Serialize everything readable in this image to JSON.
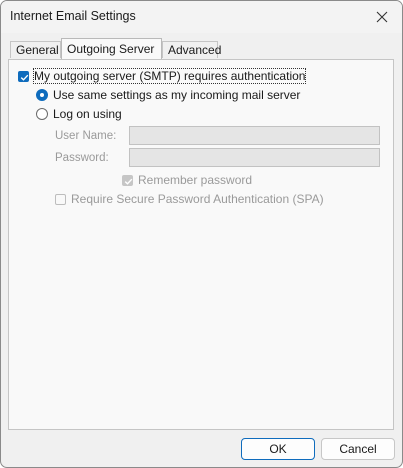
{
  "window": {
    "title": "Internet Email Settings",
    "close_icon": "close-icon"
  },
  "tabs": [
    {
      "label": "General",
      "selected": false
    },
    {
      "label": "Outgoing Server",
      "selected": true
    },
    {
      "label": "Advanced",
      "selected": false
    }
  ],
  "outgoing": {
    "requires_auth_label": "My outgoing server (SMTP) requires authentication",
    "requires_auth_checked": true,
    "same_settings_label": "Use same settings as my incoming mail server",
    "same_settings_selected": true,
    "log_on_label": "Log on using",
    "log_on_selected": false,
    "username_label": "User Name:",
    "username_value": "",
    "password_label": "Password:",
    "password_value": "",
    "remember_label": "Remember password",
    "remember_checked": true,
    "spa_label": "Require Secure Password Authentication (SPA)",
    "spa_checked": false
  },
  "buttons": {
    "ok": "OK",
    "cancel": "Cancel"
  },
  "colors": {
    "accent": "#0f6cbd",
    "disabled_text": "#9a9a9a",
    "panel_bg": "#f9f9f9",
    "dialog_bg": "#f0f0f0"
  }
}
